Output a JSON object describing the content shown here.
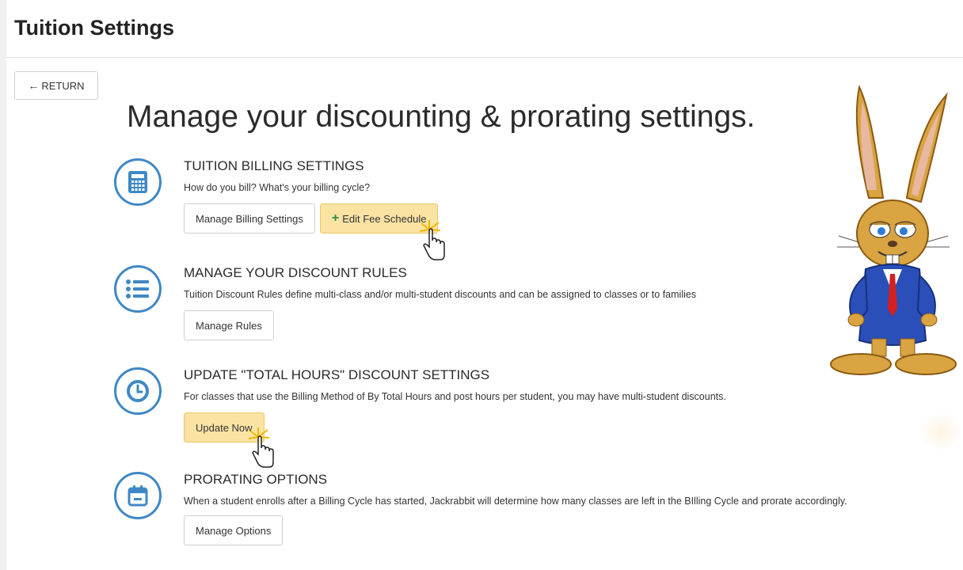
{
  "header": {
    "title": "Tuition Settings"
  },
  "return_button": {
    "label": "RETURN",
    "icon": "arrow-left-icon"
  },
  "headline": "Manage your discounting & prorating settings.",
  "sections": [
    {
      "title": "TUITION BILLING SETTINGS",
      "icon": "calculator-icon",
      "description": "How do you bill? What's your billing cycle?",
      "buttons": [
        {
          "label": "Manage Billing Settings"
        },
        {
          "label": "Edit Fee Schedule",
          "icon": "plus-icon",
          "highlighted": true
        }
      ]
    },
    {
      "title": "MANAGE YOUR DISCOUNT RULES",
      "icon": "list-icon",
      "description": "Tuition Discount Rules define multi-class and/or multi-student discounts and can be assigned to classes or to families",
      "buttons": [
        {
          "label": "Manage Rules"
        }
      ]
    },
    {
      "title": "UPDATE \"TOTAL HOURS\" DISCOUNT SETTINGS",
      "icon": "clock-icon",
      "description": "For classes that use the Billing Method of By Total Hours and post hours per student, you may have multi-student discounts.",
      "buttons": [
        {
          "label": "Update Now",
          "highlighted": true
        }
      ]
    },
    {
      "title": "PRORATING OPTIONS",
      "icon": "calendar-icon",
      "description": "When a student enrolls after a Billing Cycle has started, Jackrabbit will determine how many classes are left in the BIlling Cycle and prorate accordingly.",
      "buttons": [
        {
          "label": "Manage Options"
        }
      ]
    }
  ],
  "colors": {
    "accent": "#3f88c5",
    "highlight": "#fbe3a3",
    "plus": "#2e8b3d"
  }
}
